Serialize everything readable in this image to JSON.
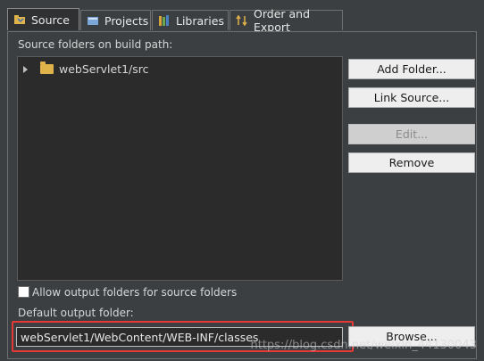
{
  "tabs": [
    {
      "label": "Source",
      "icon": "source-icon",
      "active": true
    },
    {
      "label": "Projects",
      "icon": "projects-icon",
      "active": false
    },
    {
      "label": "Libraries",
      "icon": "libraries-icon",
      "active": false
    },
    {
      "label": "Order and Export",
      "icon": "order-export-icon",
      "active": false
    }
  ],
  "source_folders_label": "Source folders on build path:",
  "tree": {
    "items": [
      {
        "label": "webServlet1/src",
        "icon": "folder-icon",
        "expanded": false
      }
    ]
  },
  "buttons": {
    "add_folder": "Add Folder...",
    "link_source": "Link Source...",
    "edit": "Edit...",
    "remove": "Remove",
    "browse": "Browse..."
  },
  "allow_output_label": "Allow output folders for source folders",
  "default_output_label": "Default output folder:",
  "default_output_value": "webServlet1/WebContent/WEB-INF/classes",
  "watermark": "https://blog.csdn.net/weixin_44130043",
  "colors": {
    "background": "#3c3f41",
    "tree_bg": "#2b2b2b",
    "highlight_box": "#e53935"
  }
}
